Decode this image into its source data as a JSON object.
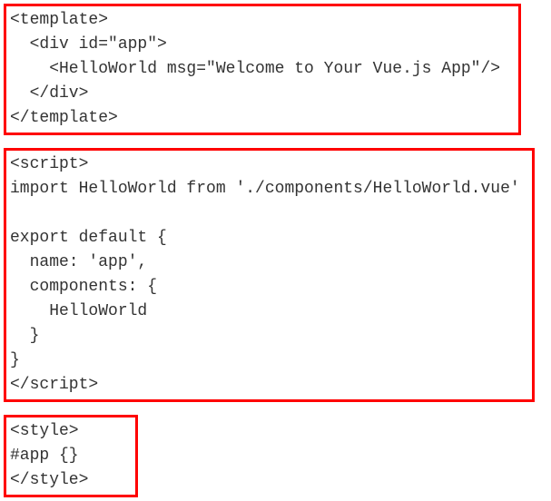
{
  "blocks": {
    "template": "<template>\n  <div id=\"app\">\n    <HelloWorld msg=\"Welcome to Your Vue.js App\"/>\n  </div>\n</template>",
    "script": "<script>\nimport HelloWorld from './components/HelloWorld.vue'\n\nexport default {\n  name: 'app',\n  components: {\n    HelloWorld\n  }\n}\n</script>",
    "style": "<style>\n#app {}\n</style>"
  }
}
